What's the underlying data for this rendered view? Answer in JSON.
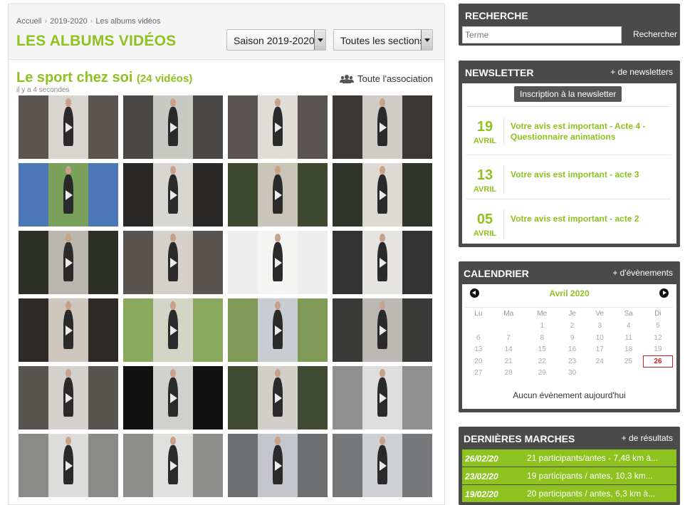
{
  "breadcrumb": [
    "Accueil",
    "2019-2020",
    "Les albums vidéos"
  ],
  "page_title": "LES ALBUMS VIDÉOS",
  "filters": {
    "season": "Saison 2019-2020",
    "section": "Toutes les sections"
  },
  "album": {
    "title": "Le sport chez soi",
    "count": "(24 vidéos)",
    "updated": "il y a 4 secondes",
    "scope": "Toute l'association"
  },
  "videos": [
    {
      "bg": "#5c5450",
      "room": "#d8d4cf"
    },
    {
      "bg": "#4a4846",
      "room": "#c9c9c4"
    },
    {
      "bg": "#5a5552",
      "room": "#e0ddd8"
    },
    {
      "bg": "#3a3735",
      "room": "#cfcbc6"
    },
    {
      "bg": "#4d78b8",
      "room": "#7aa15c"
    },
    {
      "bg": "#2a2826",
      "room": "#d8d6d0"
    },
    {
      "bg": "#3e4a30",
      "room": "#c8c4b8"
    },
    {
      "bg": "#2f3528",
      "room": "#dcdad2"
    },
    {
      "bg": "#2d3125",
      "room": "#b9b6ad"
    },
    {
      "bg": "#5a5450",
      "room": "#d6d0ca"
    },
    {
      "bg": "#eeeeee",
      "room": "#f4f4f2"
    },
    {
      "bg": "#333333",
      "room": "#e6e4e0"
    },
    {
      "bg": "#2e2a27",
      "room": "#cfc6bd"
    },
    {
      "bg": "#8aa85e",
      "room": "#d2d5c6"
    },
    {
      "bg": "#7e9a56",
      "room": "#c9cdd2"
    },
    {
      "bg": "#3a3a38",
      "room": "#bcb9b4"
    },
    {
      "bg": "#585450",
      "room": "#d4d0cb"
    },
    {
      "bg": "#111111",
      "room": "#d0d0cc"
    },
    {
      "bg": "#3e4a32",
      "room": "#d1cfc8"
    },
    {
      "bg": "#8f8f8f",
      "room": "#dedede"
    },
    {
      "bg": "#8a8a88",
      "room": "#dcdcda"
    },
    {
      "bg": "#8e8e8c",
      "room": "#e0e0de"
    },
    {
      "bg": "#6d6e70",
      "room": "#c4c6cc"
    },
    {
      "bg": "#77787a",
      "room": "#cfd0d4"
    }
  ],
  "search": {
    "title": "RECHERCHE",
    "placeholder": "Terme",
    "button": "Rechercher"
  },
  "newsletter": {
    "title": "NEWSLETTER",
    "more": "+ de newsletters",
    "subscribe": "Inscription à la newsletter",
    "items": [
      {
        "day": "19",
        "month": "AVRIL",
        "title": "Votre avis est important - Acte 4 - Questionnaire animations"
      },
      {
        "day": "13",
        "month": "AVRIL",
        "title": "Votre avis est important - acte 3"
      },
      {
        "day": "05",
        "month": "AVRIL",
        "title": "Votre avis est important - acte 2"
      }
    ]
  },
  "calendar": {
    "title": "CALENDRIER",
    "more": "+ d'évènements",
    "month": "Avril 2020",
    "weekdays": [
      "Lu",
      "Ma",
      "Me",
      "Je",
      "Ve",
      "Sa",
      "Di"
    ],
    "weeks": [
      [
        "",
        "",
        "1",
        "2",
        "3",
        "4",
        "5"
      ],
      [
        "6",
        "7",
        "8",
        "9",
        "10",
        "11",
        "12"
      ],
      [
        "13",
        "14",
        "15",
        "16",
        "17",
        "18",
        "19"
      ],
      [
        "20",
        "21",
        "22",
        "23",
        "24",
        "25",
        "26"
      ],
      [
        "27",
        "28",
        "29",
        "30",
        "",
        "",
        ""
      ]
    ],
    "today": "26",
    "no_event": "Aucun évènement aujourd'hui"
  },
  "results": {
    "title": "DERNIÈRES MARCHES",
    "more": "+ de résultats",
    "items": [
      {
        "date": "26/02/20",
        "text": "21 participants/antes - 7,48 km à..."
      },
      {
        "date": "23/02/20",
        "text": "19 participants / antes, 10,3 km..."
      },
      {
        "date": "19/02/20",
        "text": "20 participants / antes, 6,3 km à..."
      }
    ]
  }
}
